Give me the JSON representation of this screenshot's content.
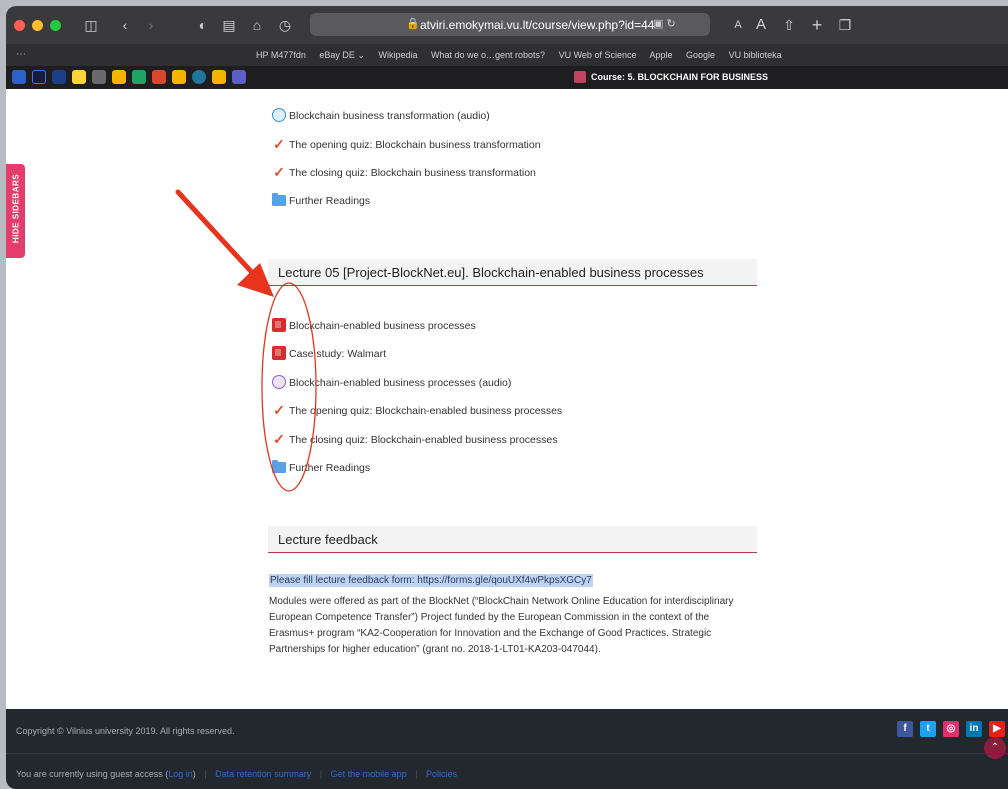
{
  "browser": {
    "url": "atviri.emokymai.vu.lt/course/view.php?id=44",
    "favorites": [
      "HP M477fdn",
      "eBay DE ⌄",
      "Wikipedia",
      "What do we o…gent robots?",
      "VU Web of Science",
      "Apple",
      "Google",
      "VU biblioteka"
    ],
    "tab_title": "Course: 5. BLOCKCHAIN FOR BUSINESS",
    "icons": [
      "sidebar-icon",
      "back-icon",
      "forward-icon",
      "privacy-icon",
      "reader-icon",
      "home-icon",
      "history-icon",
      "lock-icon",
      "translate-icon",
      "reload-icon",
      "text-smaller-icon",
      "text-larger-icon",
      "share-icon",
      "new-tab-icon",
      "tab-overview-icon"
    ]
  },
  "sidebar_toggle": "HIDE SIDEBARS",
  "previous_section": {
    "activities": [
      {
        "icon": "audio-icon",
        "label": "Blockchain business transformation (audio)"
      },
      {
        "icon": "quiz-icon",
        "label": "The opening quiz: Blockchain business transformation"
      },
      {
        "icon": "quiz-icon",
        "label": "The closing quiz: Blockchain business transformation"
      },
      {
        "icon": "folder-icon",
        "label": "Further Readings"
      }
    ]
  },
  "lecture05": {
    "title": "Lecture 05 [Project-BlockNet.eu]. Blockchain-enabled business processes",
    "activities": [
      {
        "icon": "pdf-icon",
        "label": "Blockchain-enabled business processes"
      },
      {
        "icon": "pdf-icon",
        "label": "Case study: Walmart"
      },
      {
        "icon": "audio-icon",
        "label": "Blockchain-enabled business processes (audio)"
      },
      {
        "icon": "quiz-icon",
        "label": "The opening quiz: Blockchain-enabled business processes"
      },
      {
        "icon": "quiz-icon",
        "label": "The closing quiz: Blockchain-enabled business processes"
      },
      {
        "icon": "folder-icon",
        "label": "Further Readings"
      }
    ]
  },
  "feedback": {
    "title": "Lecture feedback",
    "link_text": "Please fill lecture feedback form: https://forms.gle/qouUXf4wPkpsXGCy7",
    "modules_text": "Modules were offered as part of the BlockNet (“BlockChain Network Online Education for interdisciplinary European Competence Transfer”) Project funded by the European Commission in the context of the Erasmus+ program “KA2-Cooperation for Innovation and the Exchange of Good Practices. Strategic Partnerships for higher education” (grant no. 2018-1-LT01-KA203-047044)."
  },
  "footer": {
    "copyright": "Copyright © Vilnius university 2019. All rights reserved.",
    "guest_prefix": "You are currently using guest access (",
    "login": "Log in",
    "guest_suffix": ")",
    "links": [
      "Data retention summary",
      "Get the mobile app",
      "Policies"
    ],
    "social": [
      {
        "name": "facebook-icon",
        "glyph": "f",
        "color": "#3b5998"
      },
      {
        "name": "twitter-icon",
        "glyph": "t",
        "color": "#1da1f2"
      },
      {
        "name": "instagram-icon",
        "glyph": "◎",
        "color": "#e1306c"
      },
      {
        "name": "linkedin-icon",
        "glyph": "in",
        "color": "#0077b5"
      },
      {
        "name": "youtube-icon",
        "glyph": "▶",
        "color": "#e62117"
      }
    ]
  },
  "annotation_color": "#e8341c"
}
